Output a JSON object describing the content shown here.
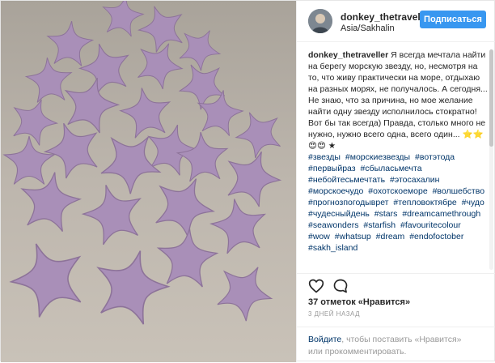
{
  "post": {
    "author": {
      "username": "donkey_thetravell",
      "location": "Asia/Sakhalin",
      "follow_label": "Подписаться"
    },
    "caption": {
      "author": "donkey_thetraveller",
      "text": "Я всегда мечтала найти на берегу морскую звезду, но, несмотря на то, что живу практически на море, отдыхаю на разных морях, не получалось. А сегодня... Не знаю, что за причина, но мое желание найти одну звезду исполнилось стократно! Вот бы так всегда) Правда, столько много не нужно, нужно всего одна, всего один... ⭐⭐😍😍 ★"
    },
    "hashtags": [
      "#звезды",
      "#морскиезвезды",
      "#вотэтода",
      "#первыйраз",
      "#сбыласьмечта",
      "#небойтесьмечтать",
      "#этосахалин",
      "#морскоечудо",
      "#охотскоеморе",
      "#волшебство",
      "#прогнозпогодыврет",
      "#тепловоктябре",
      "#чудо",
      "#чудесныйдень",
      "#stars",
      "#dreamcamethrough",
      "#seawonders",
      "#starfish",
      "#favouritecolour",
      "#wow",
      "#whatsup",
      "#dream",
      "#endofoctober",
      "#sakh_island"
    ],
    "likes": "37 отметок «Нравится»",
    "timestamp": "3 ДНЕЙ НАЗАД",
    "login_prompt": {
      "login_link": "Войдите",
      "text_middle": ", чтобы поставить «Нравится»",
      "text_end": "или прокомментировать."
    },
    "icons": {
      "like": "heart-icon",
      "comment": "comment-icon"
    },
    "colors": {
      "follow_button": "#3897f0",
      "hashtag": "#003569",
      "muted": "#999999"
    }
  }
}
